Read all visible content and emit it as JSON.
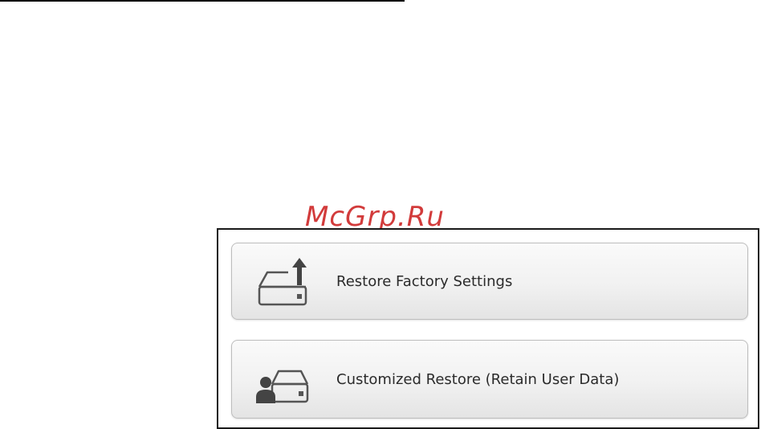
{
  "watermark": "McGrp.Ru",
  "options": [
    {
      "label": "Restore Factory Settings",
      "icon": "drive-upload-icon"
    },
    {
      "label": "Customized Restore (Retain User Data)",
      "icon": "drive-user-icon"
    }
  ],
  "colors": {
    "watermark": "#d23b3b",
    "icon_stroke": "#555555",
    "label": "#2b2b2b"
  }
}
